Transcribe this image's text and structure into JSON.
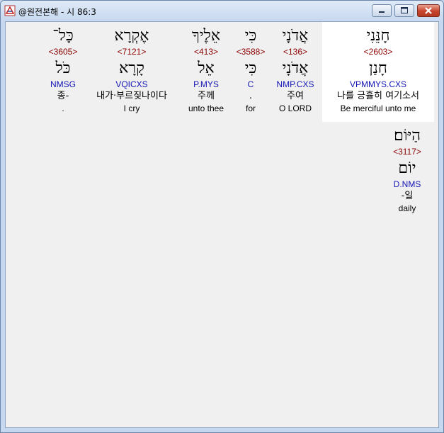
{
  "window": {
    "title": "@원전본해 - 시 86:3"
  },
  "words": [
    {
      "heb": "חָנֵּנִי",
      "strong": "<2603>",
      "root": "חָנַן",
      "morph": "VPMMYS.CXS",
      "kor": "나를 긍휼히 여기소서",
      "eng": "Be merciful unto me"
    },
    {
      "heb": "אֲדֹנָי",
      "strong": "<136>",
      "root": "אֲדֹנָי",
      "morph": "NMP.CXS",
      "kor": "주여",
      "eng": "O LORD"
    },
    {
      "heb": "כִּי",
      "strong": "<3588>",
      "root": "כִּי",
      "morph": "C",
      "kor": ".",
      "eng": "for"
    },
    {
      "heb": "אֵלֶיךָ",
      "strong": "<413>",
      "root": "אֵל",
      "morph": "P.MYS",
      "kor": "주께",
      "eng": "unto thee"
    },
    {
      "heb": "אֶקְרָא",
      "strong": "<7121>",
      "root": "קָרָא",
      "morph": "VQICXS",
      "kor": "내가·부르짖나이다",
      "eng": "I cry"
    },
    {
      "heb": "כָּל־",
      "strong": "<3605>",
      "root": "כֹּל",
      "morph": "NMSG",
      "kor": "종-",
      "eng": "."
    },
    {
      "heb": "הַיּוֹם׃",
      "strong": "<3117>",
      "root": "יוֹם",
      "morph": "D.NMS",
      "kor": "-일",
      "eng": "daily"
    }
  ]
}
